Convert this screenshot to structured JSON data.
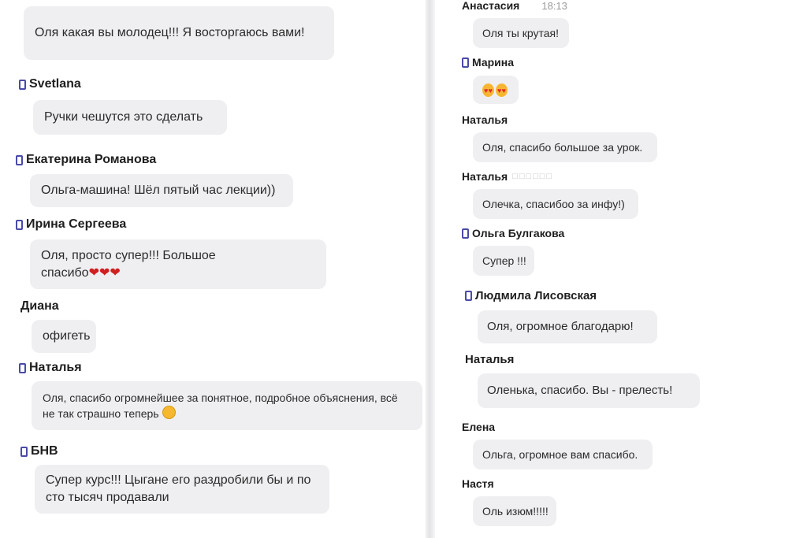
{
  "left": {
    "messages": [
      {
        "author": "",
        "text": "Оля какая вы молодец!!! Я восторгаюсь вами!"
      },
      {
        "author": "Svetlana",
        "text": "Ручки чешутся это сделать"
      },
      {
        "author": "Екатерина Романова",
        "text": "Ольга-машина! Шёл пятый час лекции))"
      },
      {
        "author": "Ирина Сергеева",
        "text": "Оля, просто супер!!! Большое спасибо",
        "emoji": "❤❤❤"
      },
      {
        "author": "Диана",
        "text": "офигеть"
      },
      {
        "author": "Наталья",
        "text": "Оля, спасибо огромнейшее за понятное, подробное объяснения, всё не так страшно теперь",
        "emoji": "smiling-face"
      },
      {
        "author": "БНВ",
        "text": "Супер курс!!! Цыгане его раздробили бы и по сто тысяч продавали"
      }
    ]
  },
  "right": {
    "messages": [
      {
        "author": "Анастасия",
        "time": "18:13",
        "text": "Оля ты крутая!"
      },
      {
        "author": "Марина",
        "text": "",
        "emoji": "heart-eyes-x2"
      },
      {
        "author": "Наталья",
        "text": "Оля, спасибо большое за урок."
      },
      {
        "author": "Наталья",
        "extra": "□□□□□□",
        "text": "Олечка, спасибоо за инфу!)"
      },
      {
        "author": "Ольга Булгакова",
        "text": "Супер !!!"
      },
      {
        "author": "Людмила Лисовская",
        "text": "Оля, огромное благодарю!"
      },
      {
        "author": "Наталья",
        "text": "Оленька, спасибо. Вы - прелесть!"
      },
      {
        "author": "Елена",
        "text": "Ольга, огромное вам спасибо."
      },
      {
        "author": "Настя",
        "text": "Оль изюм!!!!!"
      }
    ]
  },
  "colors": {
    "bubble": "#efeff2",
    "name": "#1e1e1e",
    "phone_icon": "#4a4aa8",
    "heart": "#d11e1e"
  }
}
